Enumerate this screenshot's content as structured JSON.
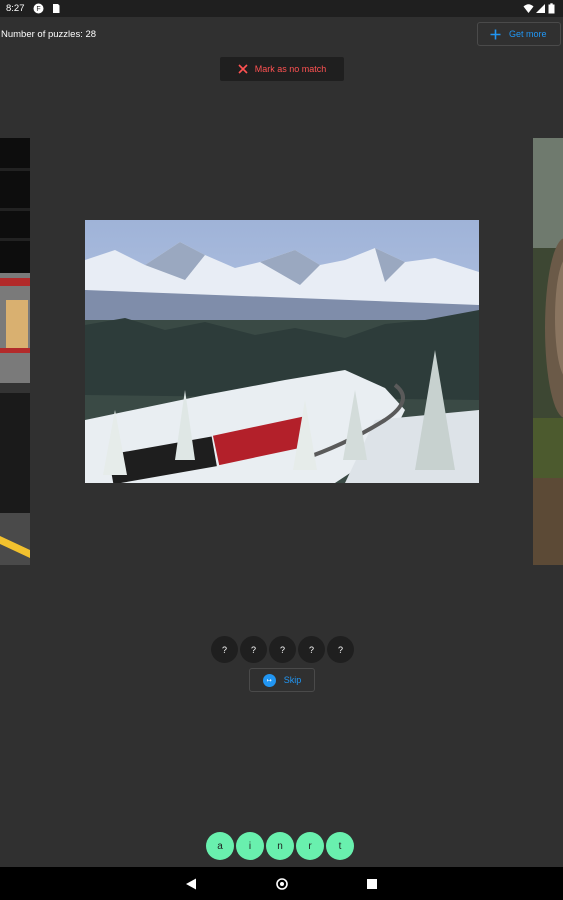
{
  "status_bar": {
    "time": "8:27",
    "icons": [
      "notification-icon",
      "sim-card-icon",
      "wifi-icon",
      "signal-icon",
      "battery-icon"
    ]
  },
  "header": {
    "puzzles_text": "Number of puzzles: 28",
    "get_more_label": "Get more"
  },
  "mark_button": {
    "label": "Mark as no match"
  },
  "answer": {
    "slots": [
      "?",
      "?",
      "?",
      "?",
      "?"
    ]
  },
  "skip": {
    "label": "Skip",
    "icon_text": "↦"
  },
  "letters": [
    "a",
    "i",
    "n",
    "r",
    "t"
  ],
  "colors": {
    "background": "#303030",
    "accent_blue": "#2196f3",
    "danger_red": "#ff5252",
    "letter_green": "#69f0ae"
  },
  "icons": {
    "nav_back": "back-triangle-icon",
    "nav_home": "home-circle-icon",
    "nav_recents": "recents-square-icon"
  }
}
